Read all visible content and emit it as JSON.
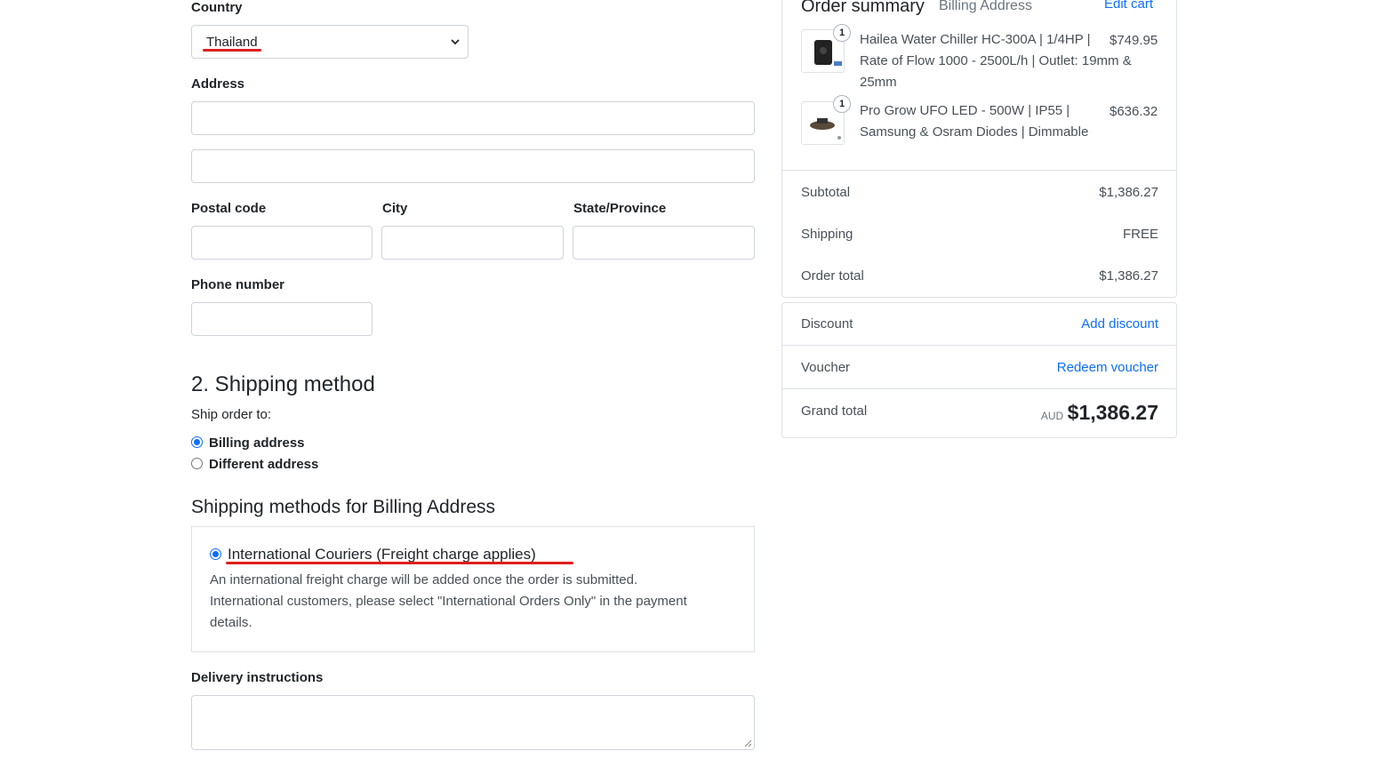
{
  "form": {
    "country_label": "Country",
    "country_value": "Thailand",
    "address_label": "Address",
    "address_line1": "",
    "address_line2": "",
    "postal_code_label": "Postal code",
    "city_label": "City",
    "state_label": "State/Province",
    "phone_label": "Phone number"
  },
  "shipping": {
    "heading": "2. Shipping method",
    "ship_to_label": "Ship order to:",
    "options": [
      {
        "label": "Billing address",
        "selected": true
      },
      {
        "label": "Different address",
        "selected": false
      }
    ],
    "methods_heading": "Shipping methods for Billing Address",
    "method": {
      "label": "International Couriers (Freight charge applies)",
      "desc_line1": "An international freight charge will be added once the order is submitted.",
      "desc_line2": "International customers, please select \"International Orders Only\" in the payment",
      "desc_line3": "details."
    },
    "delivery_label": "Delivery instructions"
  },
  "summary": {
    "title": "Order summary",
    "subtitle": "Billing Address",
    "edit_cart": "Edit cart",
    "items": [
      {
        "qty": "1",
        "line1": "Hailea Water Chiller HC-300A | 1/4HP |",
        "line2": "Rate of Flow 1000 - 2500L/h | Outlet: 19mm &",
        "line3": "25mm",
        "price": "$749.95"
      },
      {
        "qty": "1",
        "line1": "Pro Grow UFO LED - 500W | IP55 |",
        "line2": "Samsung & Osram Diodes | Dimmable",
        "price": "$636.32"
      }
    ],
    "subtotal_label": "Subtotal",
    "subtotal_value": "$1,386.27",
    "shipping_label": "Shipping",
    "shipping_value": "FREE",
    "order_total_label": "Order total",
    "order_total_value": "$1,386.27"
  },
  "discounts": {
    "discount_label": "Discount",
    "discount_link": "Add discount",
    "voucher_label": "Voucher",
    "voucher_link": "Redeem voucher",
    "grand_total_label": "Grand total",
    "currency": "AUD",
    "grand_total_value": "$1,386.27"
  },
  "colors": {
    "accent": "#0d6efd",
    "annotation": "#e01e1e"
  }
}
